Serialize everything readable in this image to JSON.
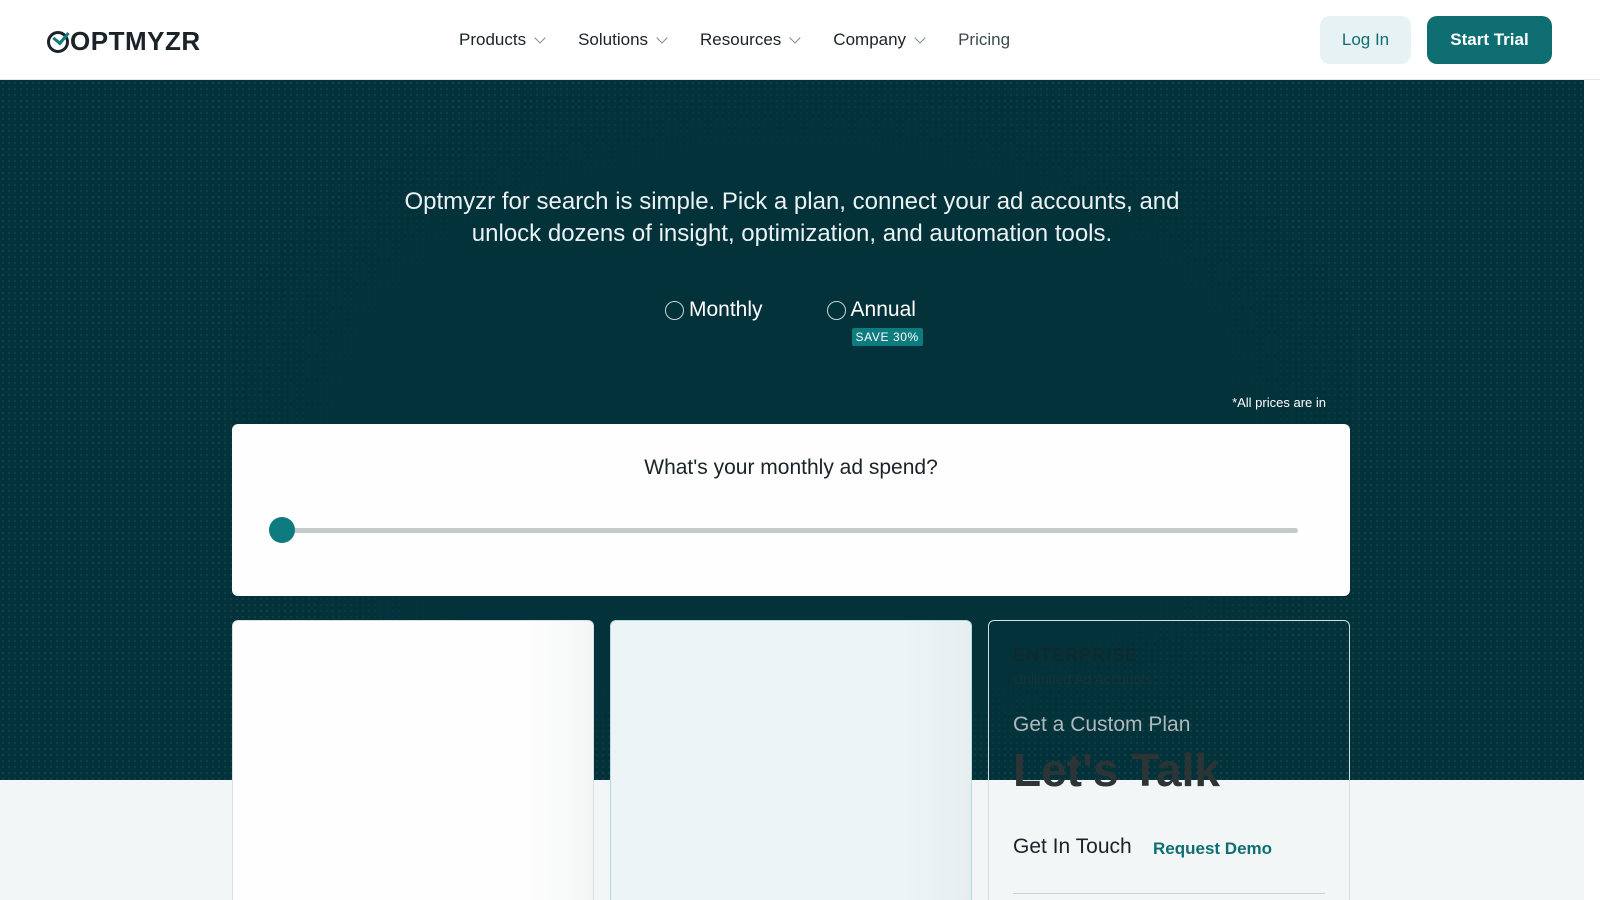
{
  "header": {
    "logo": "OPTMYZR",
    "nav": [
      {
        "label": "Products",
        "dropdown": true
      },
      {
        "label": "Solutions",
        "dropdown": true
      },
      {
        "label": "Resources",
        "dropdown": true
      },
      {
        "label": "Company",
        "dropdown": true
      },
      {
        "label": "Pricing",
        "dropdown": false
      }
    ],
    "login_label": "Log In",
    "trial_label": "Start Trial"
  },
  "hero": {
    "intro": "Optmyzr for search is simple. Pick a plan, connect your ad accounts, and unlock dozens of insight, optimization, and automation tools.",
    "billing_options": [
      "Monthly",
      "Annual"
    ],
    "selected_billing": null,
    "save_badge": "SAVE 30%",
    "price_note": "*All prices are in"
  },
  "spend": {
    "question": "What's your monthly ad spend?",
    "slider_value_fraction": 0
  },
  "enterprise_card": {
    "title": "ENTERPRISE",
    "subtitle": "Unlimited Ad Accounts",
    "custom_plan": "Get a Custom Plan",
    "headline": "Let's Talk",
    "get_in_touch": "Get In Touch",
    "request_demo": "Request Demo"
  },
  "colors": {
    "brand_teal": "#0e6e72",
    "hero_bg": "#04323a",
    "accent": "#0e7b7e"
  }
}
